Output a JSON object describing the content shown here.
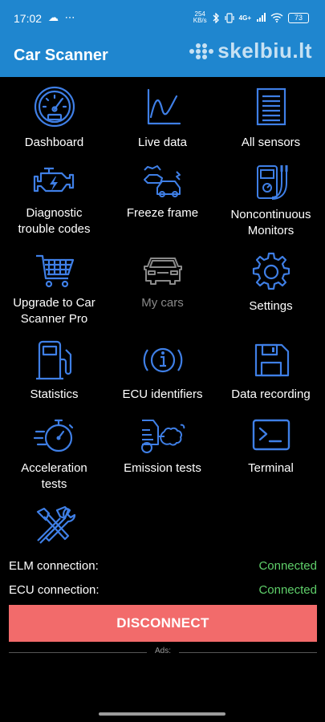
{
  "status_bar": {
    "time": "17:02",
    "left_icons": "☁ ⋯",
    "net_speed_value": "254",
    "net_speed_unit": "KB/s",
    "network": "4G+",
    "battery": "73"
  },
  "app_bar": {
    "title": "Car Scanner",
    "watermark": "skelbiu.lt"
  },
  "menu": [
    {
      "label": "Dashboard",
      "icon": "speedometer-icon"
    },
    {
      "label": "Live data",
      "icon": "line-graph-icon"
    },
    {
      "label": "All sensors",
      "icon": "list-document-icon"
    },
    {
      "label": "Diagnostic\ntrouble codes",
      "icon": "engine-icon"
    },
    {
      "label": "Freeze frame",
      "icon": "car-crash-icon"
    },
    {
      "label": "Noncontinuous\nMonitors",
      "icon": "multimeter-icon"
    },
    {
      "label": "Upgrade to Car\nScanner Pro",
      "icon": "shopping-cart-icon"
    },
    {
      "label": "My cars",
      "icon": "car-icon"
    },
    {
      "label": "Settings",
      "icon": "gear-icon"
    },
    {
      "label": "Statistics",
      "icon": "fuel-pump-icon"
    },
    {
      "label": "ECU identifiers",
      "icon": "info-icon"
    },
    {
      "label": "Data recording",
      "icon": "floppy-disk-icon"
    },
    {
      "label": "Acceleration\ntests",
      "icon": "stopwatch-icon"
    },
    {
      "label": "Emission tests",
      "icon": "exhaust-icon"
    },
    {
      "label": "Terminal",
      "icon": "terminal-icon"
    },
    {
      "label": "",
      "icon": "tools-icon"
    }
  ],
  "connections": {
    "elm_label": "ELM connection:",
    "elm_status": "Connected",
    "ecu_label": "ECU connection:",
    "ecu_status": "Connected"
  },
  "disconnect_label": "DISCONNECT",
  "ads_label": "Ads:",
  "colors": {
    "app_bar": "#1f86cf",
    "icon_blue": "#3f7fe6",
    "connected_green": "#5fcf6a",
    "disconnect_red": "#f26b6b",
    "disabled_gray": "#8a8a8a"
  }
}
